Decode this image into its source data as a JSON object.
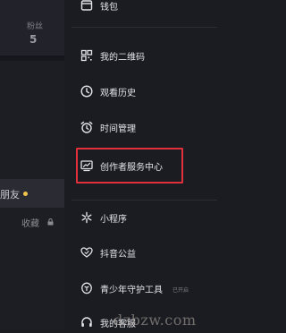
{
  "profile": {
    "fans_label": "粉丝",
    "fans_count": "5",
    "friends_label": "朋友",
    "favorites_label": "收藏"
  },
  "drawer": {
    "items": [
      {
        "label": "钱包",
        "icon": "wallet-icon"
      },
      {
        "label": "我的二维码",
        "icon": "qr-code-icon"
      },
      {
        "label": "观看历史",
        "icon": "history-clock-icon"
      },
      {
        "label": "时间管理",
        "icon": "alarm-clock-icon"
      },
      {
        "label": "创作者服务中心",
        "icon": "creator-chart-icon"
      },
      {
        "label": "小程序",
        "icon": "mini-program-icon"
      },
      {
        "label": "抖音公益",
        "icon": "heart-charity-icon"
      },
      {
        "label": "青少年守护工具",
        "icon": "youth-protection-icon",
        "badge": "已开启"
      },
      {
        "label": "我的客服",
        "icon": "headset-icon"
      }
    ]
  },
  "watermark": "dzbzw.com",
  "colors": {
    "background": "#1b1c22",
    "highlight": "#e0313a",
    "online_dot": "#f2c54b"
  }
}
